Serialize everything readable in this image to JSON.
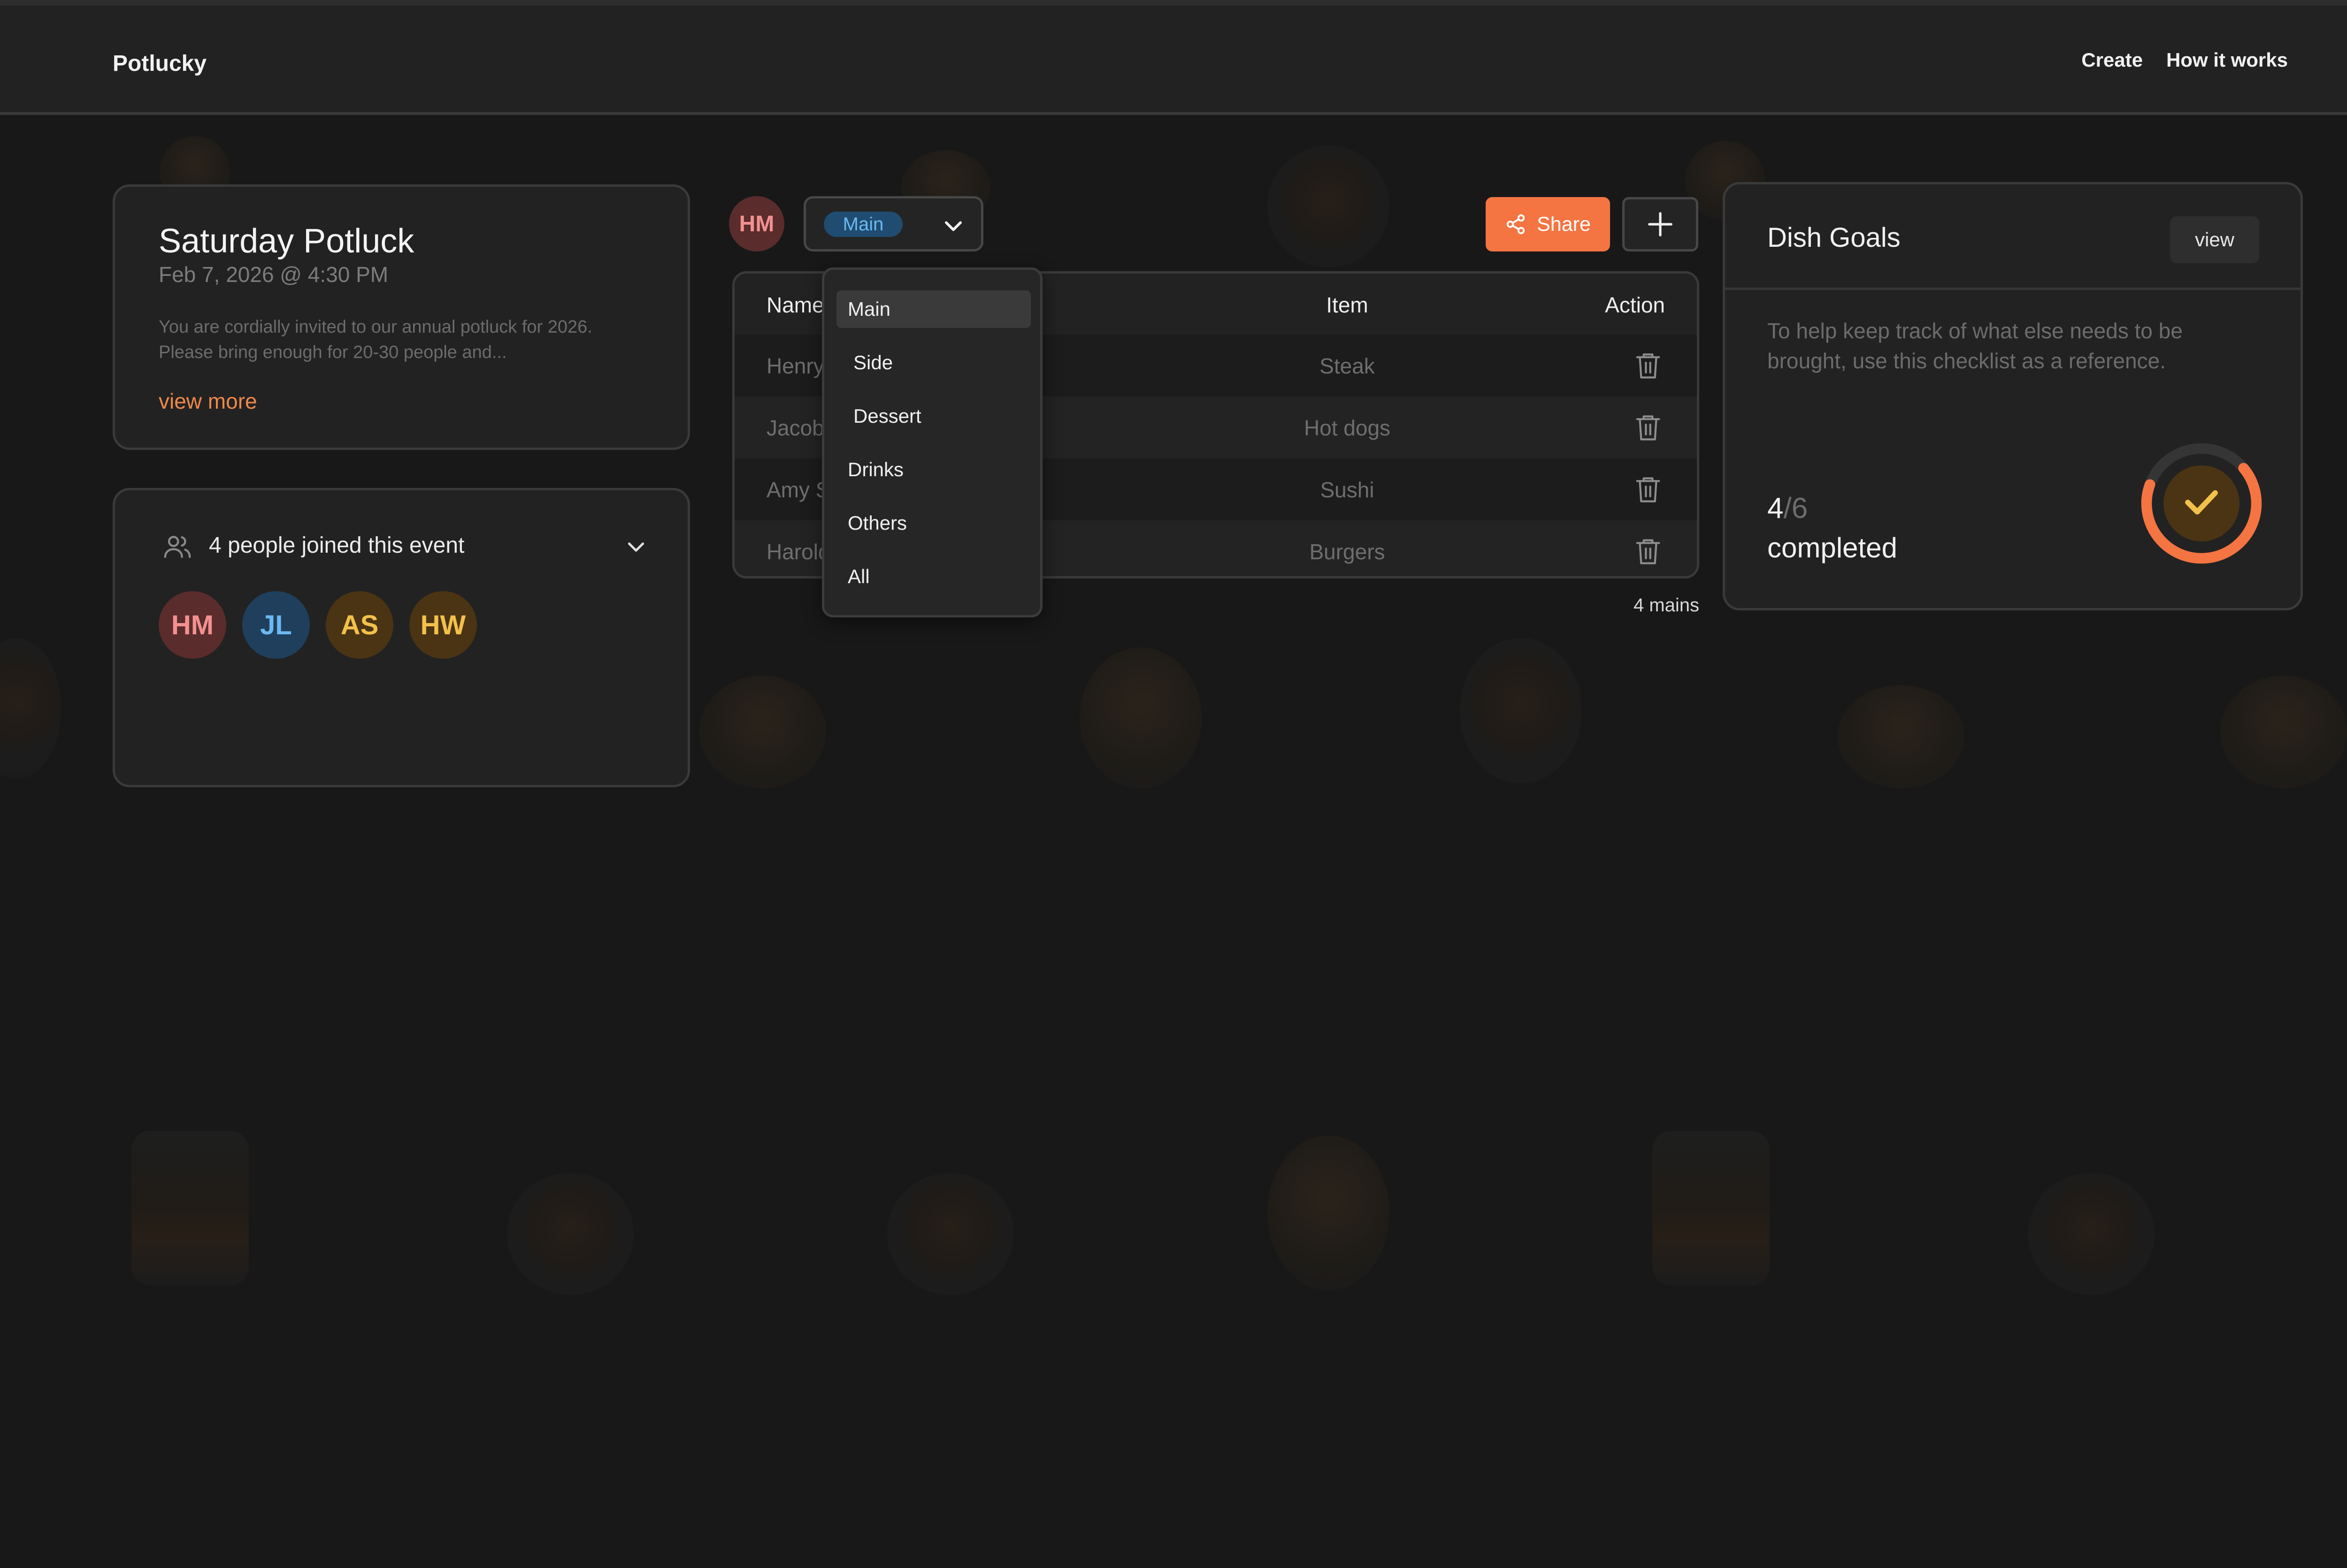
{
  "app": {
    "brand": "Potlucky"
  },
  "nav": {
    "create": "Create",
    "how_it_works": "How it works"
  },
  "event": {
    "title": "Saturday Potluck",
    "date": "Feb 7, 2026 @ 4:30 PM",
    "description": "You are cordially invited to our annual potluck for 2026. Please bring enough for 20-30 people and...",
    "view_more": "view more"
  },
  "people": {
    "joined_text": "4 people joined this event",
    "avatars": [
      {
        "initials": "HM",
        "bg": "#5a2c2c",
        "fg": "#f29090"
      },
      {
        "initials": "JL",
        "bg": "#1f3f5c",
        "fg": "#6cb8f2"
      },
      {
        "initials": "AS",
        "bg": "#4a3414",
        "fg": "#f2c14a"
      },
      {
        "initials": "HW",
        "bg": "#4a3414",
        "fg": "#f2c14a"
      }
    ]
  },
  "toolbar": {
    "owner_initials": "HM",
    "selected_category": "Main",
    "share_label": "Share"
  },
  "dropdown": {
    "options": [
      "Main",
      "Side",
      "Dessert",
      "Drinks",
      "Others",
      "All"
    ],
    "active": "Main"
  },
  "table": {
    "headers": {
      "name": "Name",
      "item": "Item",
      "action": "Action"
    },
    "rows": [
      {
        "name": "Henry",
        "item": "Steak"
      },
      {
        "name": "Jacob",
        "item": "Hot dogs"
      },
      {
        "name": "Amy S",
        "item": "Sushi"
      },
      {
        "name": "Harold",
        "item": "Burgers"
      }
    ],
    "count_label": "4 mains"
  },
  "goals": {
    "title": "Dish Goals",
    "view_label": "view",
    "description": "To help keep track of what else needs to be brought, use this checklist as a reference.",
    "completed_count": "4",
    "total_count": "6",
    "completed_label": "completed",
    "progress_fraction": 0.6667,
    "ring_color": "#f47442"
  }
}
